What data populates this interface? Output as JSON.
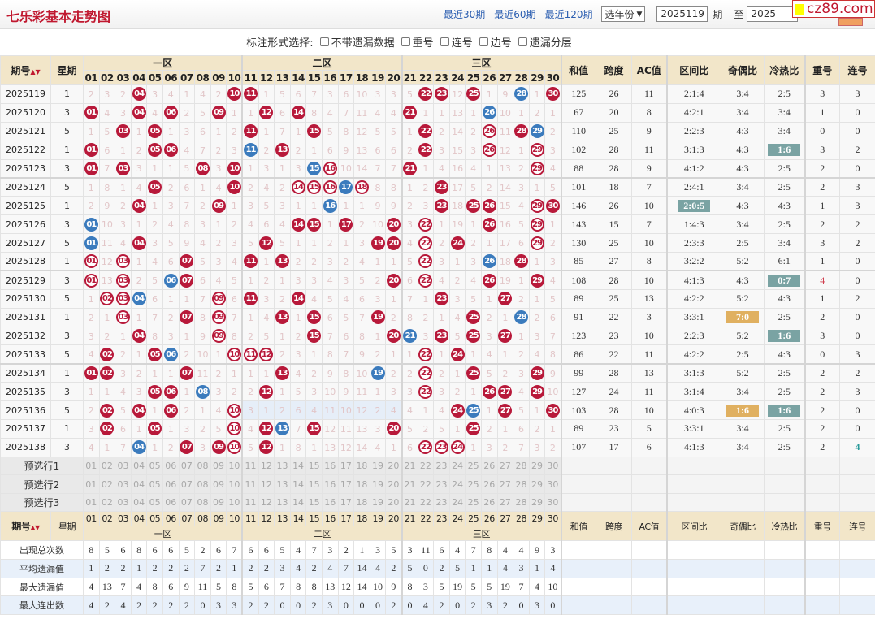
{
  "header": {
    "title": "七乐彩基本走势图",
    "links": [
      "最近30期",
      "最近60期",
      "最近120期"
    ],
    "year_select": "选年份",
    "from_issue": "2025119",
    "from_label": "期",
    "to_label": "至",
    "to_issue": "2025",
    "watermark": "cz89.com"
  },
  "options": {
    "label": "标注形式选择:",
    "items": [
      "不带遗漏数据",
      "重号",
      "连号",
      "边号",
      "遗漏分层"
    ]
  },
  "columns": {
    "issue": "期号",
    "week": "星期",
    "zones": [
      "一区",
      "二区",
      "三区"
    ],
    "numbers": [
      "01",
      "02",
      "03",
      "04",
      "05",
      "06",
      "07",
      "08",
      "09",
      "10",
      "11",
      "12",
      "13",
      "14",
      "15",
      "16",
      "17",
      "18",
      "19",
      "20",
      "21",
      "22",
      "23",
      "24",
      "25",
      "26",
      "27",
      "28",
      "29",
      "30"
    ],
    "stats": [
      "和值",
      "跨度",
      "AC值",
      "区间比",
      "奇偶比",
      "冷热比",
      "重号",
      "连号"
    ]
  },
  "rows": [
    {
      "issue": "2025119",
      "week": "1",
      "nums": [
        "2",
        "3",
        "2",
        "r04",
        "3",
        "4",
        "1",
        "4",
        "2",
        "r10",
        "r11",
        "1",
        "5",
        "6",
        "7",
        "3",
        "6",
        "10",
        "3",
        "3",
        "5",
        "r22",
        "r23",
        "12",
        "r25",
        "1",
        "9",
        "b28",
        "1",
        "r30"
      ],
      "stats": [
        "125",
        "26",
        "11",
        "2:1:4",
        "3:4",
        "2:5",
        "3",
        "3"
      ]
    },
    {
      "issue": "2025120",
      "week": "3",
      "nums": [
        "r01",
        "4",
        "3",
        "r04",
        "4",
        "r06",
        "2",
        "5",
        "r09",
        "1",
        "1",
        "r12",
        "6",
        "r14",
        "8",
        "4",
        "7",
        "11",
        "4",
        "4",
        "r21",
        "1",
        "1",
        "13",
        "1",
        "b26",
        "10",
        "1",
        "2",
        "1"
      ],
      "stats": [
        "67",
        "20",
        "8",
        "4:2:1",
        "3:4",
        "3:4",
        "1",
        "0"
      ]
    },
    {
      "issue": "2025121",
      "week": "5",
      "nums": [
        "1",
        "5",
        "r03",
        "1",
        "r05",
        "1",
        "3",
        "6",
        "1",
        "2",
        "r11",
        "1",
        "7",
        "1",
        "r15",
        "5",
        "8",
        "12",
        "5",
        "5",
        "1",
        "r22",
        "2",
        "14",
        "2",
        "o26",
        "11",
        "r28",
        "b29",
        "2"
      ],
      "stats": [
        "110",
        "25",
        "9",
        "2:2:3",
        "4:3",
        "3:4",
        "0",
        "0"
      ]
    },
    {
      "issue": "2025122",
      "week": "1",
      "nums": [
        "r01",
        "6",
        "1",
        "2",
        "r05",
        "r06",
        "4",
        "7",
        "2",
        "3",
        "b11",
        "2",
        "r13",
        "2",
        "1",
        "6",
        "9",
        "13",
        "6",
        "6",
        "2",
        "r22",
        "3",
        "15",
        "3",
        "o26",
        "12",
        "1",
        "o29",
        "3"
      ],
      "stats": [
        "102",
        "28",
        "11",
        "3:1:3",
        "4:3",
        "1:6",
        "3",
        "2"
      ],
      "marks": {
        "5": "teal"
      }
    },
    {
      "issue": "2025123",
      "week": "3",
      "nums": [
        "r01",
        "7",
        "r03",
        "3",
        "1",
        "1",
        "5",
        "r08",
        "3",
        "r10",
        "1",
        "3",
        "1",
        "3",
        "b15",
        "o16",
        "10",
        "14",
        "7",
        "7",
        "r21",
        "1",
        "4",
        "16",
        "4",
        "1",
        "13",
        "2",
        "o29",
        "4"
      ],
      "stats": [
        "88",
        "28",
        "9",
        "4:1:2",
        "4:3",
        "2:5",
        "2",
        "0"
      ]
    },
    {
      "issue": "2025124",
      "week": "5",
      "nums": [
        "1",
        "8",
        "1",
        "4",
        "r05",
        "2",
        "6",
        "1",
        "4",
        "r10",
        "2",
        "4",
        "2",
        "o14",
        "o15",
        "o16",
        "b17",
        "o18",
        "8",
        "8",
        "1",
        "2",
        "r23",
        "17",
        "5",
        "2",
        "14",
        "3",
        "1",
        "5"
      ],
      "stats": [
        "101",
        "18",
        "7",
        "2:4:1",
        "3:4",
        "2:5",
        "2",
        "3"
      ]
    },
    {
      "issue": "2025125",
      "week": "1",
      "nums": [
        "2",
        "9",
        "2",
        "r04",
        "1",
        "3",
        "7",
        "2",
        "r09",
        "1",
        "3",
        "5",
        "3",
        "1",
        "1",
        "b16",
        "1",
        "1",
        "9",
        "9",
        "2",
        "3",
        "r23",
        "18",
        "r25",
        "r26",
        "15",
        "4",
        "o29",
        "r30"
      ],
      "stats": [
        "146",
        "26",
        "10",
        "2:0:5",
        "4:3",
        "4:3",
        "1",
        "3"
      ],
      "marks": {
        "3": "teal"
      }
    },
    {
      "issue": "2025126",
      "week": "3",
      "nums": [
        "b01",
        "10",
        "3",
        "1",
        "2",
        "4",
        "8",
        "3",
        "1",
        "2",
        "4",
        "6",
        "4",
        "r14",
        "r15",
        "1",
        "r17",
        "2",
        "10",
        "r20",
        "3",
        "o22",
        "1",
        "19",
        "1",
        "r26",
        "16",
        "5",
        "o29",
        "1"
      ],
      "stats": [
        "143",
        "15",
        "7",
        "1:4:3",
        "3:4",
        "2:5",
        "2",
        "2"
      ]
    },
    {
      "issue": "2025127",
      "week": "5",
      "nums": [
        "b01",
        "11",
        "4",
        "r04",
        "3",
        "5",
        "9",
        "4",
        "2",
        "3",
        "5",
        "r12",
        "5",
        "1",
        "1",
        "2",
        "1",
        "3",
        "r19",
        "r20",
        "4",
        "o22",
        "2",
        "r24",
        "2",
        "1",
        "17",
        "6",
        "o29",
        "2"
      ],
      "stats": [
        "130",
        "25",
        "10",
        "2:3:3",
        "2:5",
        "3:4",
        "3",
        "2"
      ]
    },
    {
      "issue": "2025128",
      "week": "1",
      "nums": [
        "o01",
        "12",
        "o03",
        "1",
        "4",
        "6",
        "r07",
        "5",
        "3",
        "4",
        "r11",
        "1",
        "r13",
        "2",
        "2",
        "3",
        "2",
        "4",
        "1",
        "1",
        "5",
        "o22",
        "3",
        "1",
        "3",
        "b26",
        "18",
        "r28",
        "1",
        "3"
      ],
      "stats": [
        "85",
        "27",
        "8",
        "3:2:2",
        "5:2",
        "6:1",
        "1",
        "0"
      ]
    },
    {
      "issue": "2025129",
      "week": "3",
      "nums": [
        "o01",
        "13",
        "o03",
        "2",
        "5",
        "b06",
        "r07",
        "6",
        "4",
        "5",
        "1",
        "2",
        "1",
        "3",
        "3",
        "4",
        "3",
        "5",
        "2",
        "r20",
        "6",
        "o22",
        "4",
        "2",
        "4",
        "r26",
        "19",
        "1",
        "r29",
        "4"
      ],
      "stats": [
        "108",
        "28",
        "10",
        "4:1:3",
        "4:3",
        "0:7",
        "4",
        "0"
      ],
      "marks": {
        "5": "teal",
        "6": "red"
      }
    },
    {
      "issue": "2025130",
      "week": "5",
      "nums": [
        "1",
        "o02",
        "o03",
        "b04",
        "6",
        "1",
        "1",
        "7",
        "o09",
        "6",
        "r11",
        "3",
        "2",
        "r14",
        "4",
        "5",
        "4",
        "6",
        "3",
        "1",
        "7",
        "1",
        "r23",
        "3",
        "5",
        "1",
        "r27",
        "2",
        "1",
        "5"
      ],
      "stats": [
        "89",
        "25",
        "13",
        "4:2:2",
        "5:2",
        "4:3",
        "1",
        "2"
      ]
    },
    {
      "issue": "2025131",
      "week": "1",
      "nums": [
        "2",
        "1",
        "o03",
        "1",
        "7",
        "2",
        "r07",
        "8",
        "o09",
        "7",
        "1",
        "4",
        "r13",
        "1",
        "r15",
        "6",
        "5",
        "7",
        "r19",
        "2",
        "8",
        "2",
        "1",
        "4",
        "r25",
        "2",
        "1",
        "b28",
        "2",
        "6"
      ],
      "stats": [
        "91",
        "22",
        "3",
        "3:3:1",
        "7:0",
        "2:5",
        "2",
        "0"
      ],
      "marks": {
        "4": "orange"
      }
    },
    {
      "issue": "2025132",
      "week": "3",
      "nums": [
        "3",
        "2",
        "1",
        "r04",
        "8",
        "3",
        "1",
        "9",
        "o09",
        "8",
        "2",
        "5",
        "1",
        "2",
        "r15",
        "7",
        "6",
        "8",
        "1",
        "r20",
        "b21",
        "3",
        "r23",
        "5",
        "r25",
        "3",
        "r27",
        "1",
        "3",
        "7"
      ],
      "stats": [
        "123",
        "23",
        "10",
        "2:2:3",
        "5:2",
        "1:6",
        "3",
        "0"
      ],
      "marks": {
        "5": "teal"
      }
    },
    {
      "issue": "2025133",
      "week": "5",
      "nums": [
        "4",
        "r02",
        "2",
        "1",
        "r05",
        "b06",
        "2",
        "10",
        "1",
        "o10",
        "o11",
        "o12",
        "2",
        "3",
        "1",
        "8",
        "7",
        "9",
        "2",
        "1",
        "1",
        "o22",
        "1",
        "r24",
        "1",
        "4",
        "1",
        "2",
        "4",
        "8"
      ],
      "stats": [
        "86",
        "22",
        "11",
        "4:2:2",
        "2:5",
        "4:3",
        "0",
        "3"
      ]
    },
    {
      "issue": "2025134",
      "week": "1",
      "nums": [
        "r01",
        "r02",
        "3",
        "2",
        "1",
        "1",
        "r07",
        "11",
        "2",
        "1",
        "1",
        "1",
        "r13",
        "4",
        "2",
        "9",
        "8",
        "10",
        "b19",
        "2",
        "2",
        "o22",
        "2",
        "1",
        "r25",
        "5",
        "2",
        "3",
        "r29",
        "9"
      ],
      "stats": [
        "99",
        "28",
        "13",
        "3:1:3",
        "5:2",
        "2:5",
        "2",
        "2"
      ]
    },
    {
      "issue": "2025135",
      "week": "3",
      "nums": [
        "1",
        "1",
        "4",
        "3",
        "r05",
        "r06",
        "1",
        "b08",
        "3",
        "2",
        "2",
        "r12",
        "1",
        "5",
        "3",
        "10",
        "9",
        "11",
        "1",
        "3",
        "3",
        "o22",
        "3",
        "2",
        "1",
        "r26",
        "r27",
        "4",
        "r29",
        "10"
      ],
      "stats": [
        "127",
        "24",
        "11",
        "3:1:4",
        "3:4",
        "2:5",
        "2",
        "3"
      ]
    },
    {
      "issue": "2025136",
      "week": "5",
      "nums": [
        "2",
        "r02",
        "5",
        "r04",
        "1",
        "r06",
        "2",
        "1",
        "4",
        "o10",
        "3",
        "1",
        "2",
        "6",
        "4",
        "11",
        "10",
        "12",
        "2",
        "4",
        "4",
        "1",
        "4",
        "r24",
        "b25",
        "1",
        "r27",
        "5",
        "1",
        "r30"
      ],
      "stats": [
        "103",
        "28",
        "10",
        "4:0:3",
        "1:6",
        "1:6",
        "2",
        "0"
      ],
      "marks": {
        "4": "orange",
        "5": "teal"
      },
      "shade": "zone2"
    },
    {
      "issue": "2025137",
      "week": "1",
      "nums": [
        "3",
        "r02",
        "6",
        "1",
        "r05",
        "1",
        "3",
        "2",
        "5",
        "o10",
        "4",
        "r12",
        "b13",
        "7",
        "r15",
        "12",
        "11",
        "13",
        "3",
        "r20",
        "5",
        "2",
        "5",
        "1",
        "r25",
        "2",
        "1",
        "6",
        "2",
        "1"
      ],
      "stats": [
        "89",
        "23",
        "5",
        "3:3:1",
        "3:4",
        "2:5",
        "2",
        "0"
      ]
    },
    {
      "issue": "2025138",
      "week": "3",
      "nums": [
        "4",
        "1",
        "7",
        "b04",
        "1",
        "2",
        "r07",
        "3",
        "r09",
        "o10",
        "5",
        "r12",
        "1",
        "8",
        "1",
        "13",
        "12",
        "14",
        "4",
        "1",
        "6",
        "o22",
        "o23",
        "o24",
        "1",
        "3",
        "2",
        "7",
        "3",
        "2"
      ],
      "stats": [
        "107",
        "17",
        "6",
        "4:1:3",
        "3:4",
        "2:5",
        "2",
        "4"
      ],
      "marks": {
        "7": "teal-text"
      }
    }
  ],
  "preselect": [
    "预选行1",
    "预选行2",
    "预选行3"
  ],
  "summary": [
    {
      "label": "出现总次数",
      "values": [
        "8",
        "5",
        "6",
        "8",
        "6",
        "6",
        "5",
        "2",
        "6",
        "7",
        "6",
        "6",
        "5",
        "4",
        "7",
        "3",
        "2",
        "1",
        "3",
        "5",
        "3",
        "11",
        "6",
        "4",
        "7",
        "8",
        "4",
        "4",
        "9",
        "3"
      ]
    },
    {
      "label": "平均遗漏值",
      "values": [
        "1",
        "2",
        "2",
        "1",
        "2",
        "2",
        "2",
        "7",
        "2",
        "1",
        "2",
        "2",
        "3",
        "4",
        "2",
        "4",
        "7",
        "14",
        "4",
        "2",
        "5",
        "0",
        "2",
        "5",
        "1",
        "1",
        "4",
        "3",
        "1",
        "4"
      ]
    },
    {
      "label": "最大遗漏值",
      "values": [
        "4",
        "13",
        "7",
        "4",
        "8",
        "6",
        "9",
        "11",
        "5",
        "8",
        "5",
        "6",
        "7",
        "8",
        "8",
        "13",
        "12",
        "14",
        "10",
        "9",
        "8",
        "3",
        "5",
        "19",
        "5",
        "5",
        "19",
        "7",
        "4",
        "10"
      ]
    },
    {
      "label": "最大连出数",
      "values": [
        "4",
        "2",
        "4",
        "2",
        "2",
        "2",
        "2",
        "0",
        "3",
        "3",
        "2",
        "2",
        "0",
        "0",
        "2",
        "3",
        "0",
        "0",
        "0",
        "2",
        "0",
        "4",
        "2",
        "0",
        "2",
        "3",
        "2",
        "0",
        "3",
        "0"
      ]
    }
  ],
  "colors": {
    "red_ball": "#b8193a",
    "blue_ball": "#3b7bbd",
    "teal_mark": "#7aa3a3",
    "orange_mark": "#e0b060",
    "header_bg": "#f2e6c9"
  }
}
